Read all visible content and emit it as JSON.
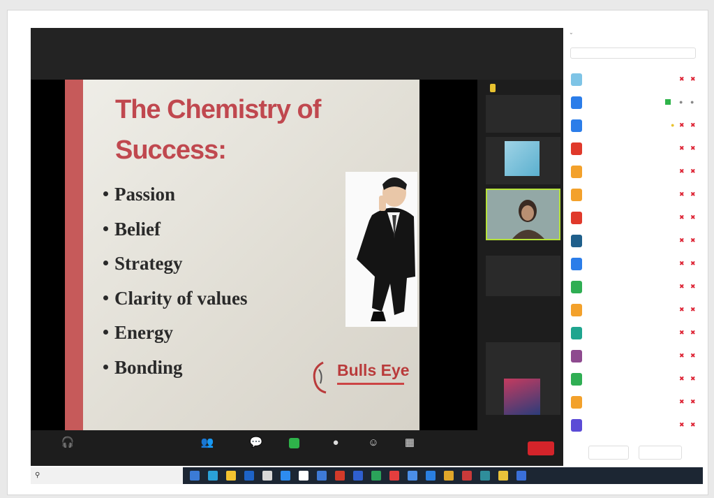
{
  "slide": {
    "title_line1": "The Chemistry of",
    "title_line2": "Success:",
    "bullets": [
      "Passion",
      "Belief",
      "Strategy",
      "Clarity of values",
      "Energy",
      "Bonding"
    ],
    "logo_text": "Bulls Eye"
  },
  "gallery": {
    "tile1_label": "",
    "tile2_label": "",
    "tile3_label": "",
    "tile4_label": "",
    "tile5_label": ""
  },
  "toolbar": {
    "audio_label": "",
    "participants_label": "",
    "chat_label": "",
    "share_label": "",
    "record_label": "",
    "reactions_label": "",
    "apps_label": "",
    "end_label": ""
  },
  "participants_panel": {
    "title": "",
    "search_placeholder": "",
    "items": [
      {
        "initial": "",
        "name": "",
        "color": "#7ec4e6"
      },
      {
        "initial": "",
        "name": "",
        "color": "#2b7de9"
      },
      {
        "initial": "",
        "name": "",
        "color": "#2b7de9"
      },
      {
        "initial": "",
        "name": "",
        "color": "#e0392b"
      },
      {
        "initial": "",
        "name": "",
        "color": "#f3a12b"
      },
      {
        "initial": "",
        "name": "",
        "color": "#f3a12b"
      },
      {
        "initial": "",
        "name": "",
        "color": "#e0392b"
      },
      {
        "initial": "",
        "name": "",
        "color": "#1f5f8b"
      },
      {
        "initial": "",
        "name": "",
        "color": "#2b7de9"
      },
      {
        "initial": "",
        "name": "",
        "color": "#2fae53"
      },
      {
        "initial": "",
        "name": "",
        "color": "#f3a12b"
      },
      {
        "initial": "",
        "name": "",
        "color": "#1fa58f"
      },
      {
        "initial": "",
        "name": "",
        "color": "#8e4a8f"
      },
      {
        "initial": "",
        "name": "",
        "color": "#2fae53"
      },
      {
        "initial": "",
        "name": "",
        "color": "#f3a12b"
      },
      {
        "initial": "",
        "name": "",
        "color": "#5b4bd6"
      }
    ],
    "button_left": "",
    "button_right": ""
  },
  "taskbar": {
    "search_placeholder": "",
    "tray_text": ""
  }
}
